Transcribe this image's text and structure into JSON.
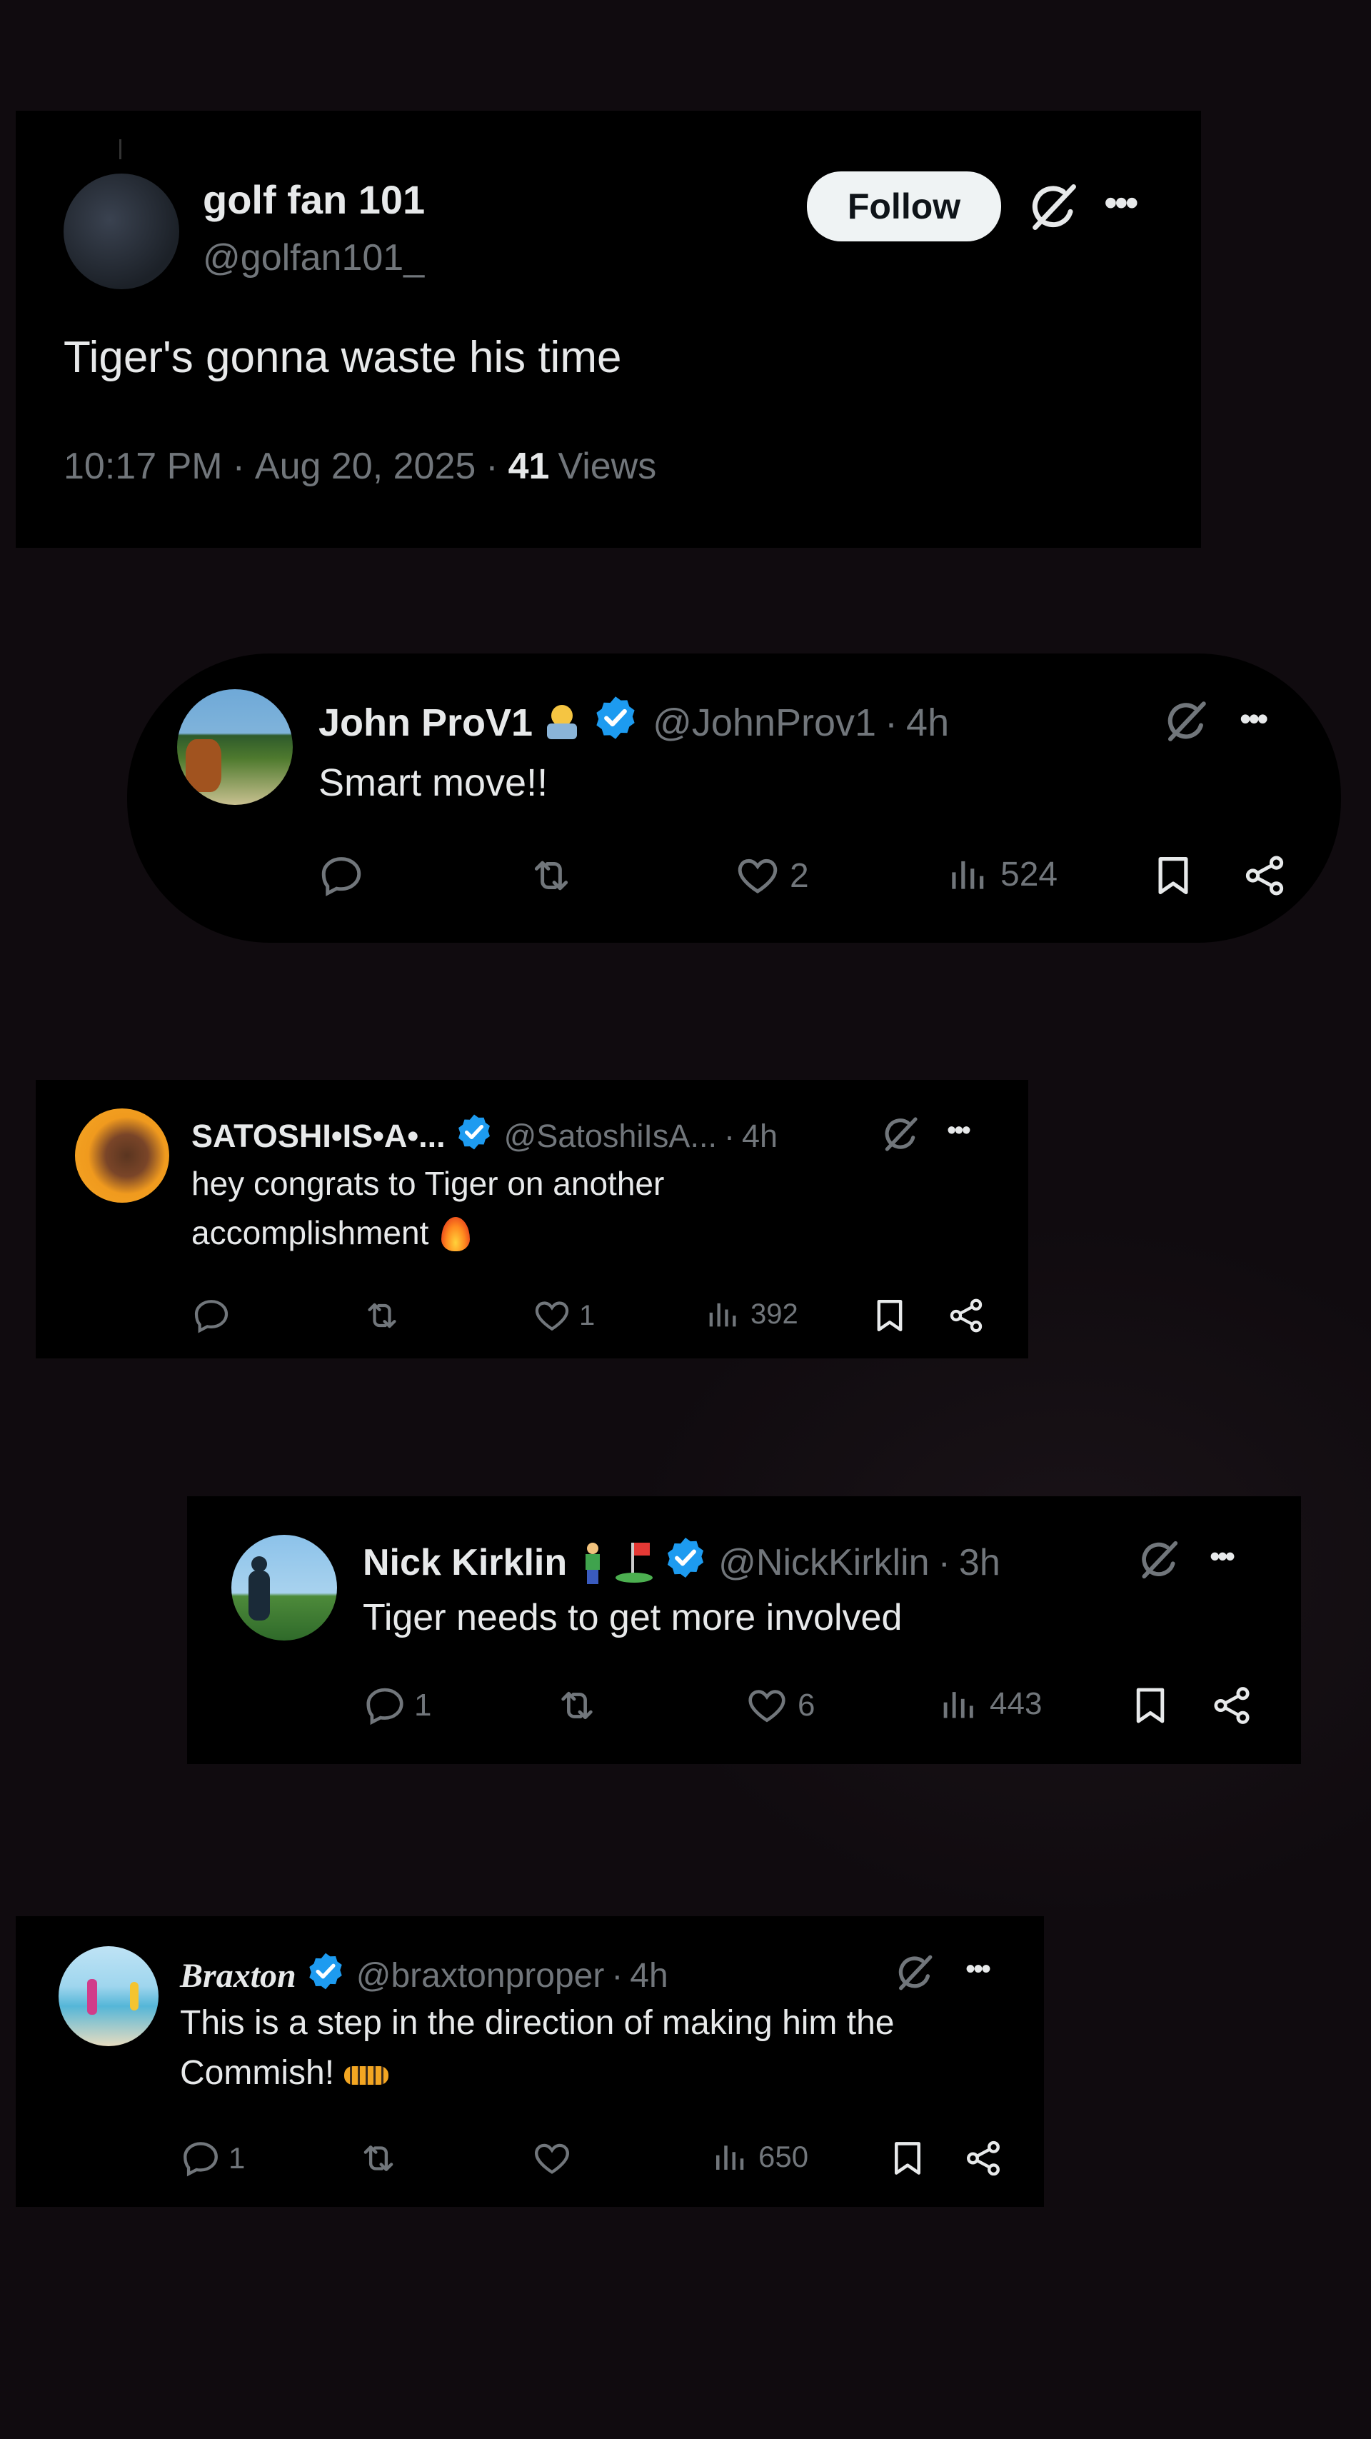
{
  "main_post": {
    "display_name": "golf fan 101",
    "handle": "@golfan101_",
    "follow_label": "Follow",
    "text": "Tiger's gonna waste his time",
    "time": "10:17 PM",
    "date": "Aug 20, 2025",
    "views_count": "41",
    "views_label": "Views"
  },
  "replies": [
    {
      "display_name": "John ProV1",
      "handle": "@JohnProv1",
      "age": "4h",
      "text": "Smart move!!",
      "reply_count": "",
      "like_count": "2",
      "view_count": "524",
      "name_emoji": "technologist"
    },
    {
      "display_name": "SATOSHI•IS•A•...",
      "handle": "@SatoshiIsA...",
      "age": "4h",
      "text_line1": "hey congrats to Tiger on another",
      "text_line2": "accomplishment",
      "text_emoji": "fire",
      "reply_count": "",
      "like_count": "1",
      "view_count": "392"
    },
    {
      "display_name": "Nick Kirklin",
      "handle": "@NickKirklin",
      "age": "3h",
      "text": "Tiger needs to get more involved",
      "reply_count": "1",
      "like_count": "6",
      "view_count": "443",
      "name_emoji": "golfer, flag-in-hole"
    },
    {
      "display_name": "Braxton",
      "handle": "@braxtonproper",
      "age": "4h",
      "text_line1": "This is a step in the direction of making him the",
      "text_line2": "Commish!",
      "text_emoji": "tiger",
      "reply_count": "1",
      "like_count": "",
      "view_count": "650"
    }
  ],
  "colors": {
    "background": "#100b0f",
    "card": "#000000",
    "text_primary": "#e7e9ea",
    "text_muted": "#71767b",
    "verified_blue": "#1d9bf0",
    "follow_bg": "#eff3f4"
  },
  "icons": [
    "reply-icon",
    "retweet-icon",
    "like-icon",
    "views-icon",
    "bookmark-icon",
    "share-icon",
    "grok-icon",
    "more-icon",
    "verified-badge-icon"
  ],
  "separator": "·"
}
